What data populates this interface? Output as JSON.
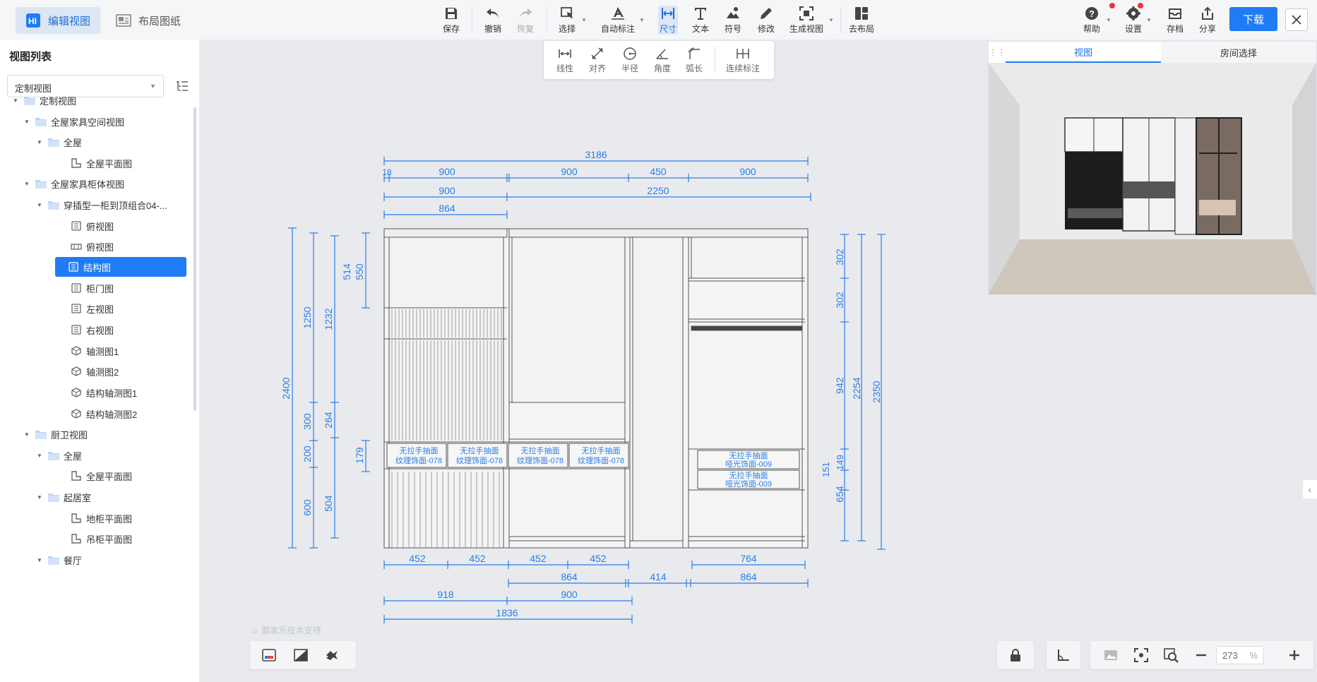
{
  "topbar": {
    "modes": [
      {
        "label": "编辑视图",
        "active": true
      },
      {
        "label": "布局图纸",
        "active": false
      }
    ],
    "tools": {
      "save": "保存",
      "undo": "撤销",
      "redo": "恢复",
      "select": "选择",
      "auto_dim": "自动标注",
      "dimension": "尺寸",
      "text": "文本",
      "symbol": "符号",
      "modify": "修改",
      "gen_view": "生成视图",
      "to_layout": "去布局"
    },
    "right": {
      "help": "帮助",
      "settings": "设置",
      "archive": "存档",
      "share": "分享",
      "download": "下载"
    }
  },
  "dim_toolbar": {
    "linear": "线性",
    "aligned": "对齐",
    "radius": "半径",
    "angle": "角度",
    "arc": "弧长",
    "continuous": "连续标注"
  },
  "left_panel": {
    "title": "视图列表",
    "select_value": "定制视图",
    "tree": [
      {
        "label": "定制视图"
      },
      {
        "label": "全屋家具空间视图"
      },
      {
        "label": "全屋"
      },
      {
        "label": "全屋平面图"
      },
      {
        "label": "全屋家具柜体视图"
      },
      {
        "label": "穿插型一柜到顶组合04-..."
      },
      {
        "label": "俯视图"
      },
      {
        "label": "俯视图"
      },
      {
        "label": "结构图"
      },
      {
        "label": "柜门图"
      },
      {
        "label": "左视图"
      },
      {
        "label": "右视图"
      },
      {
        "label": "轴测图1"
      },
      {
        "label": "轴测图2"
      },
      {
        "label": "结构轴测图1"
      },
      {
        "label": "结构轴测图2"
      },
      {
        "label": "厨卫视图"
      },
      {
        "label": "全屋"
      },
      {
        "label": "全屋平面图"
      },
      {
        "label": "起居室"
      },
      {
        "label": "地柜平面图"
      },
      {
        "label": "吊柜平面图"
      },
      {
        "label": "餐厅"
      }
    ]
  },
  "preview": {
    "tab_view": "视图",
    "tab_room": "房间选择"
  },
  "drawing": {
    "top_dims": {
      "overall": "3186",
      "row2": [
        "18",
        "900",
        "900",
        "450",
        "900"
      ],
      "row3": [
        "900",
        "2250"
      ],
      "row4": "864"
    },
    "left_dims": {
      "overall": "2400",
      "col2": [
        "1250",
        "300",
        "200",
        "600"
      ],
      "col3": [
        "1232",
        "264",
        "504"
      ],
      "col4": [
        "514",
        "550",
        "179"
      ]
    },
    "right_dims": {
      "overall": "2350",
      "col2": "2254",
      "col1": [
        "302",
        "302",
        "942",
        "151",
        "149",
        "654"
      ]
    },
    "bottom_dims": {
      "row1": [
        "452",
        "452",
        "452",
        "452",
        "764"
      ],
      "row2": [
        "864",
        "414",
        "864"
      ],
      "row3": [
        "918",
        "900"
      ],
      "row4": "1836"
    },
    "labels": {
      "drawer_line1": "无拉手抽面",
      "drawer_line2_a": "纹理饰面-078",
      "drawer_line2_b": "哑光饰面-009"
    }
  },
  "watermark": "酷家乐技术支持",
  "zoom": {
    "value": "273",
    "unit": "%"
  },
  "colors": {
    "accent": "#1f7cf5",
    "dim": "#2a7ee8",
    "cabinet": "#555555"
  }
}
